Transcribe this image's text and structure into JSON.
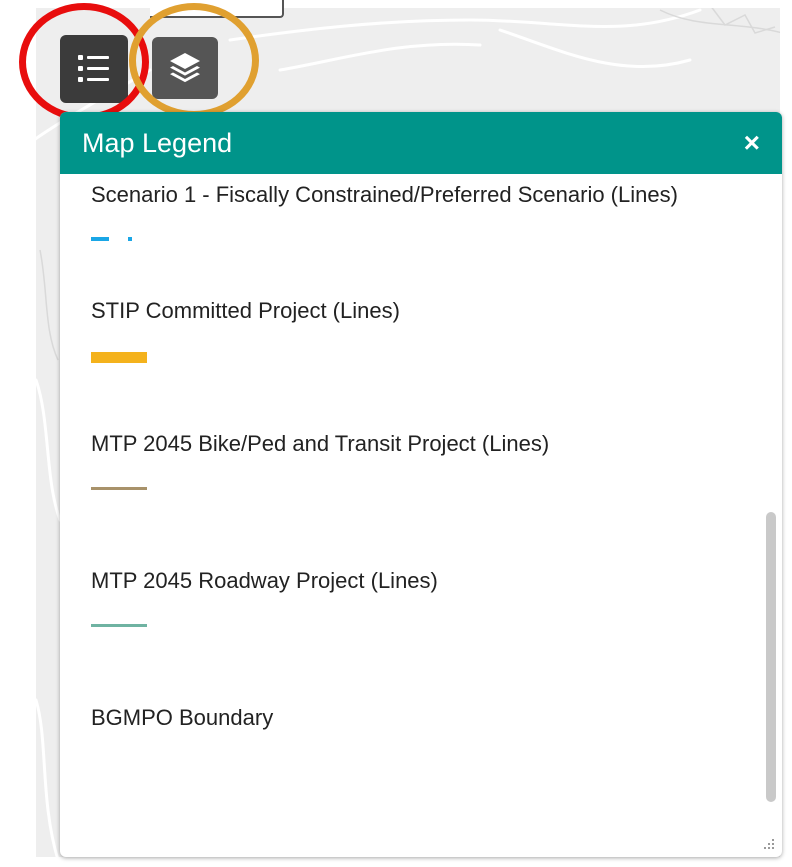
{
  "legend_panel": {
    "title": "Map Legend",
    "close_label": "×",
    "header_color": "#00948a",
    "items": [
      {
        "label": "Scenario 1 - Fiscally Constrained/Preferred Scenario (Lines)",
        "symbol": "dash-dot",
        "color": "#1aa6e6"
      },
      {
        "label": "STIP Committed Project (Lines)",
        "symbol": "thick-solid",
        "color": "#f4b21c"
      },
      {
        "label": "MTP 2045 Bike/Ped and Transit Project (Lines)",
        "symbol": "thin-solid",
        "color": "#a8926a"
      },
      {
        "label": "MTP 2045 Roadway Project (Lines)",
        "symbol": "thin-solid",
        "color": "#6fb3a2"
      },
      {
        "label": "BGMPO Boundary",
        "symbol": "none",
        "color": "#000000"
      }
    ]
  },
  "toolbar": {
    "legend_button_icon": "list-icon",
    "layers_button_icon": "layers-icon"
  },
  "annotations": {
    "red_ring_color": "#e80d0d",
    "orange_ring_color": "#e0a030"
  }
}
